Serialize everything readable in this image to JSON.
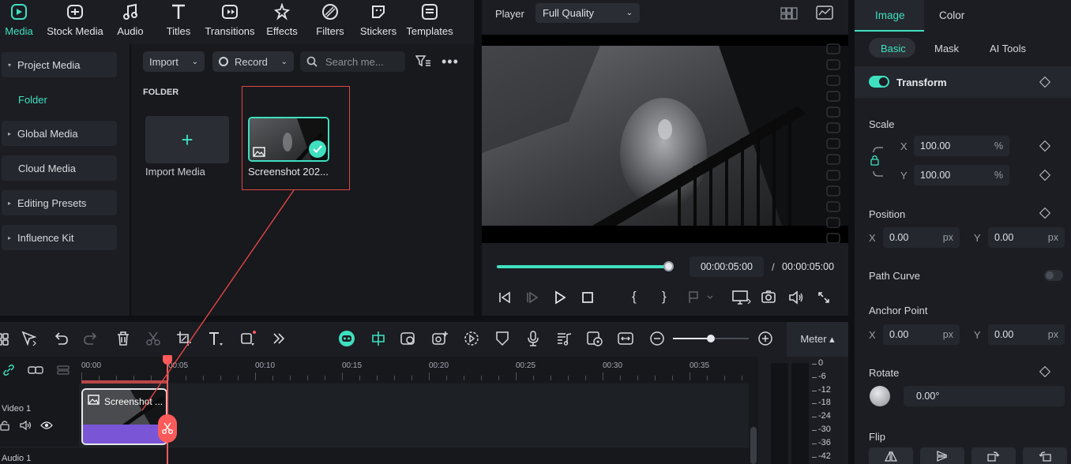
{
  "topbar": {
    "tools": [
      {
        "label": "Media",
        "icon": "media-icon",
        "active": true
      },
      {
        "label": "Stock Media",
        "icon": "stock-media-icon"
      },
      {
        "label": "Audio",
        "icon": "music-note-icon"
      },
      {
        "label": "Titles",
        "icon": "title-t-icon"
      },
      {
        "label": "Transitions",
        "icon": "transitions-icon"
      },
      {
        "label": "Effects",
        "icon": "effects-icon"
      },
      {
        "label": "Filters",
        "icon": "filters-icon"
      },
      {
        "label": "Stickers",
        "icon": "stickers-icon"
      },
      {
        "label": "Templates",
        "icon": "templates-icon"
      }
    ]
  },
  "sidebar": {
    "items": [
      {
        "label": "Project Media"
      },
      {
        "label": "Folder"
      },
      {
        "label": "Global Media"
      },
      {
        "label": "Cloud Media"
      },
      {
        "label": "Editing Presets"
      },
      {
        "label": "Influence Kit"
      }
    ]
  },
  "media": {
    "import_label": "Import",
    "record_label": "Record",
    "search_placeholder": "Search me...",
    "folder_heading": "FOLDER",
    "import_media_label": "Import Media",
    "clip_name": "Screenshot 202..."
  },
  "player": {
    "label": "Player",
    "quality": "Full Quality",
    "current_time": "00:00:05:00",
    "separator": "/",
    "total_time": "00:00:05:00",
    "progress": 1.0
  },
  "panel": {
    "tabs": [
      "Image",
      "Color"
    ],
    "subtabs": [
      "Basic",
      "Mask",
      "AI Tools"
    ],
    "transform_label": "Transform",
    "scale_label": "Scale",
    "scale_x_axis": "X",
    "scale_y_axis": "Y",
    "scale_x": "100.00",
    "scale_y": "100.00",
    "percent": "%",
    "position_label": "Position",
    "pos_x_axis": "X",
    "pos_y_axis": "Y",
    "pos_x": "0.00",
    "pos_y": "0.00",
    "px": "px",
    "path_curve_label": "Path Curve",
    "anchor_label": "Anchor Point",
    "anchor_x_axis": "X",
    "anchor_y_axis": "Y",
    "anchor_x": "0.00",
    "anchor_y": "0.00",
    "rotate_label": "Rotate",
    "rotate_value": "0.00°",
    "flip_label": "Flip"
  },
  "timeline": {
    "meter_label": "Meter ▴",
    "ruler_ticks": [
      "00:00",
      "00:05",
      "00:10",
      "00:15",
      "00:20",
      "00:25",
      "00:30",
      "00:35"
    ],
    "track_video": "Video 1",
    "track_audio": "Audio 1",
    "clip_label": "Screenshot ...",
    "meter_scale": [
      "0",
      "-6",
      "-12",
      "-18",
      "-24",
      "-30",
      "-36",
      "-42"
    ]
  },
  "colors": {
    "accent": "#3fe0c0",
    "playhead": "#ff5a5a",
    "clip_purple": "#7a55d6"
  }
}
